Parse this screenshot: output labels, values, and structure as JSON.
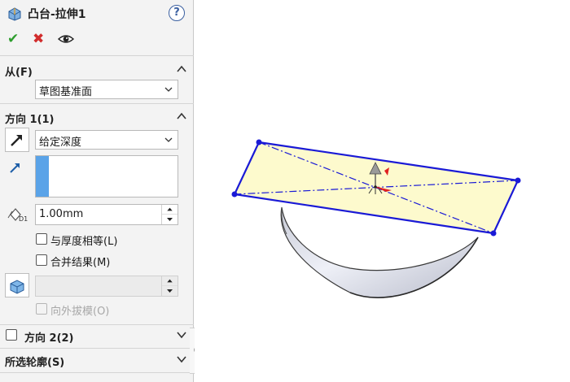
{
  "panel": {
    "title": "凸台-拉伸1",
    "help_label": "?",
    "actions": {
      "ok": "✔",
      "cancel": "✖"
    },
    "from": {
      "title": "从(F)",
      "value": "草图基准面"
    },
    "direction1": {
      "title": "方向 1(1)",
      "end_condition": "给定深度",
      "depth_value": "1.00mm",
      "checkboxes": [
        {
          "label": "与厚度相等(L)",
          "checked": false,
          "enabled": true
        },
        {
          "label": "合并结果(M)",
          "checked": false,
          "enabled": true
        },
        {
          "label": "向外拔模(O)",
          "checked": false,
          "enabled": false
        }
      ],
      "draft_value": ""
    },
    "direction2": {
      "title": "方向 2(2)",
      "checked": false
    },
    "selected_contours": {
      "title": "所选轮廓(S)"
    }
  },
  "colors": {
    "sketch_outline": "#1a1ad6",
    "sketch_fill": "#fdf9c8",
    "accent_blue": "#5aa3e8",
    "ok_green": "#2e9e2e",
    "cancel_red": "#d12c2c"
  },
  "icons": [
    "extrude-feature-icon",
    "help-icon",
    "ok-check-icon",
    "cancel-x-icon",
    "preview-eye-icon",
    "reverse-direction-icon",
    "direction-arrow-icon",
    "depth-dimension-icon",
    "draft-icon",
    "chevron-up-icon",
    "chevron-down-icon",
    "triad-icon"
  ]
}
